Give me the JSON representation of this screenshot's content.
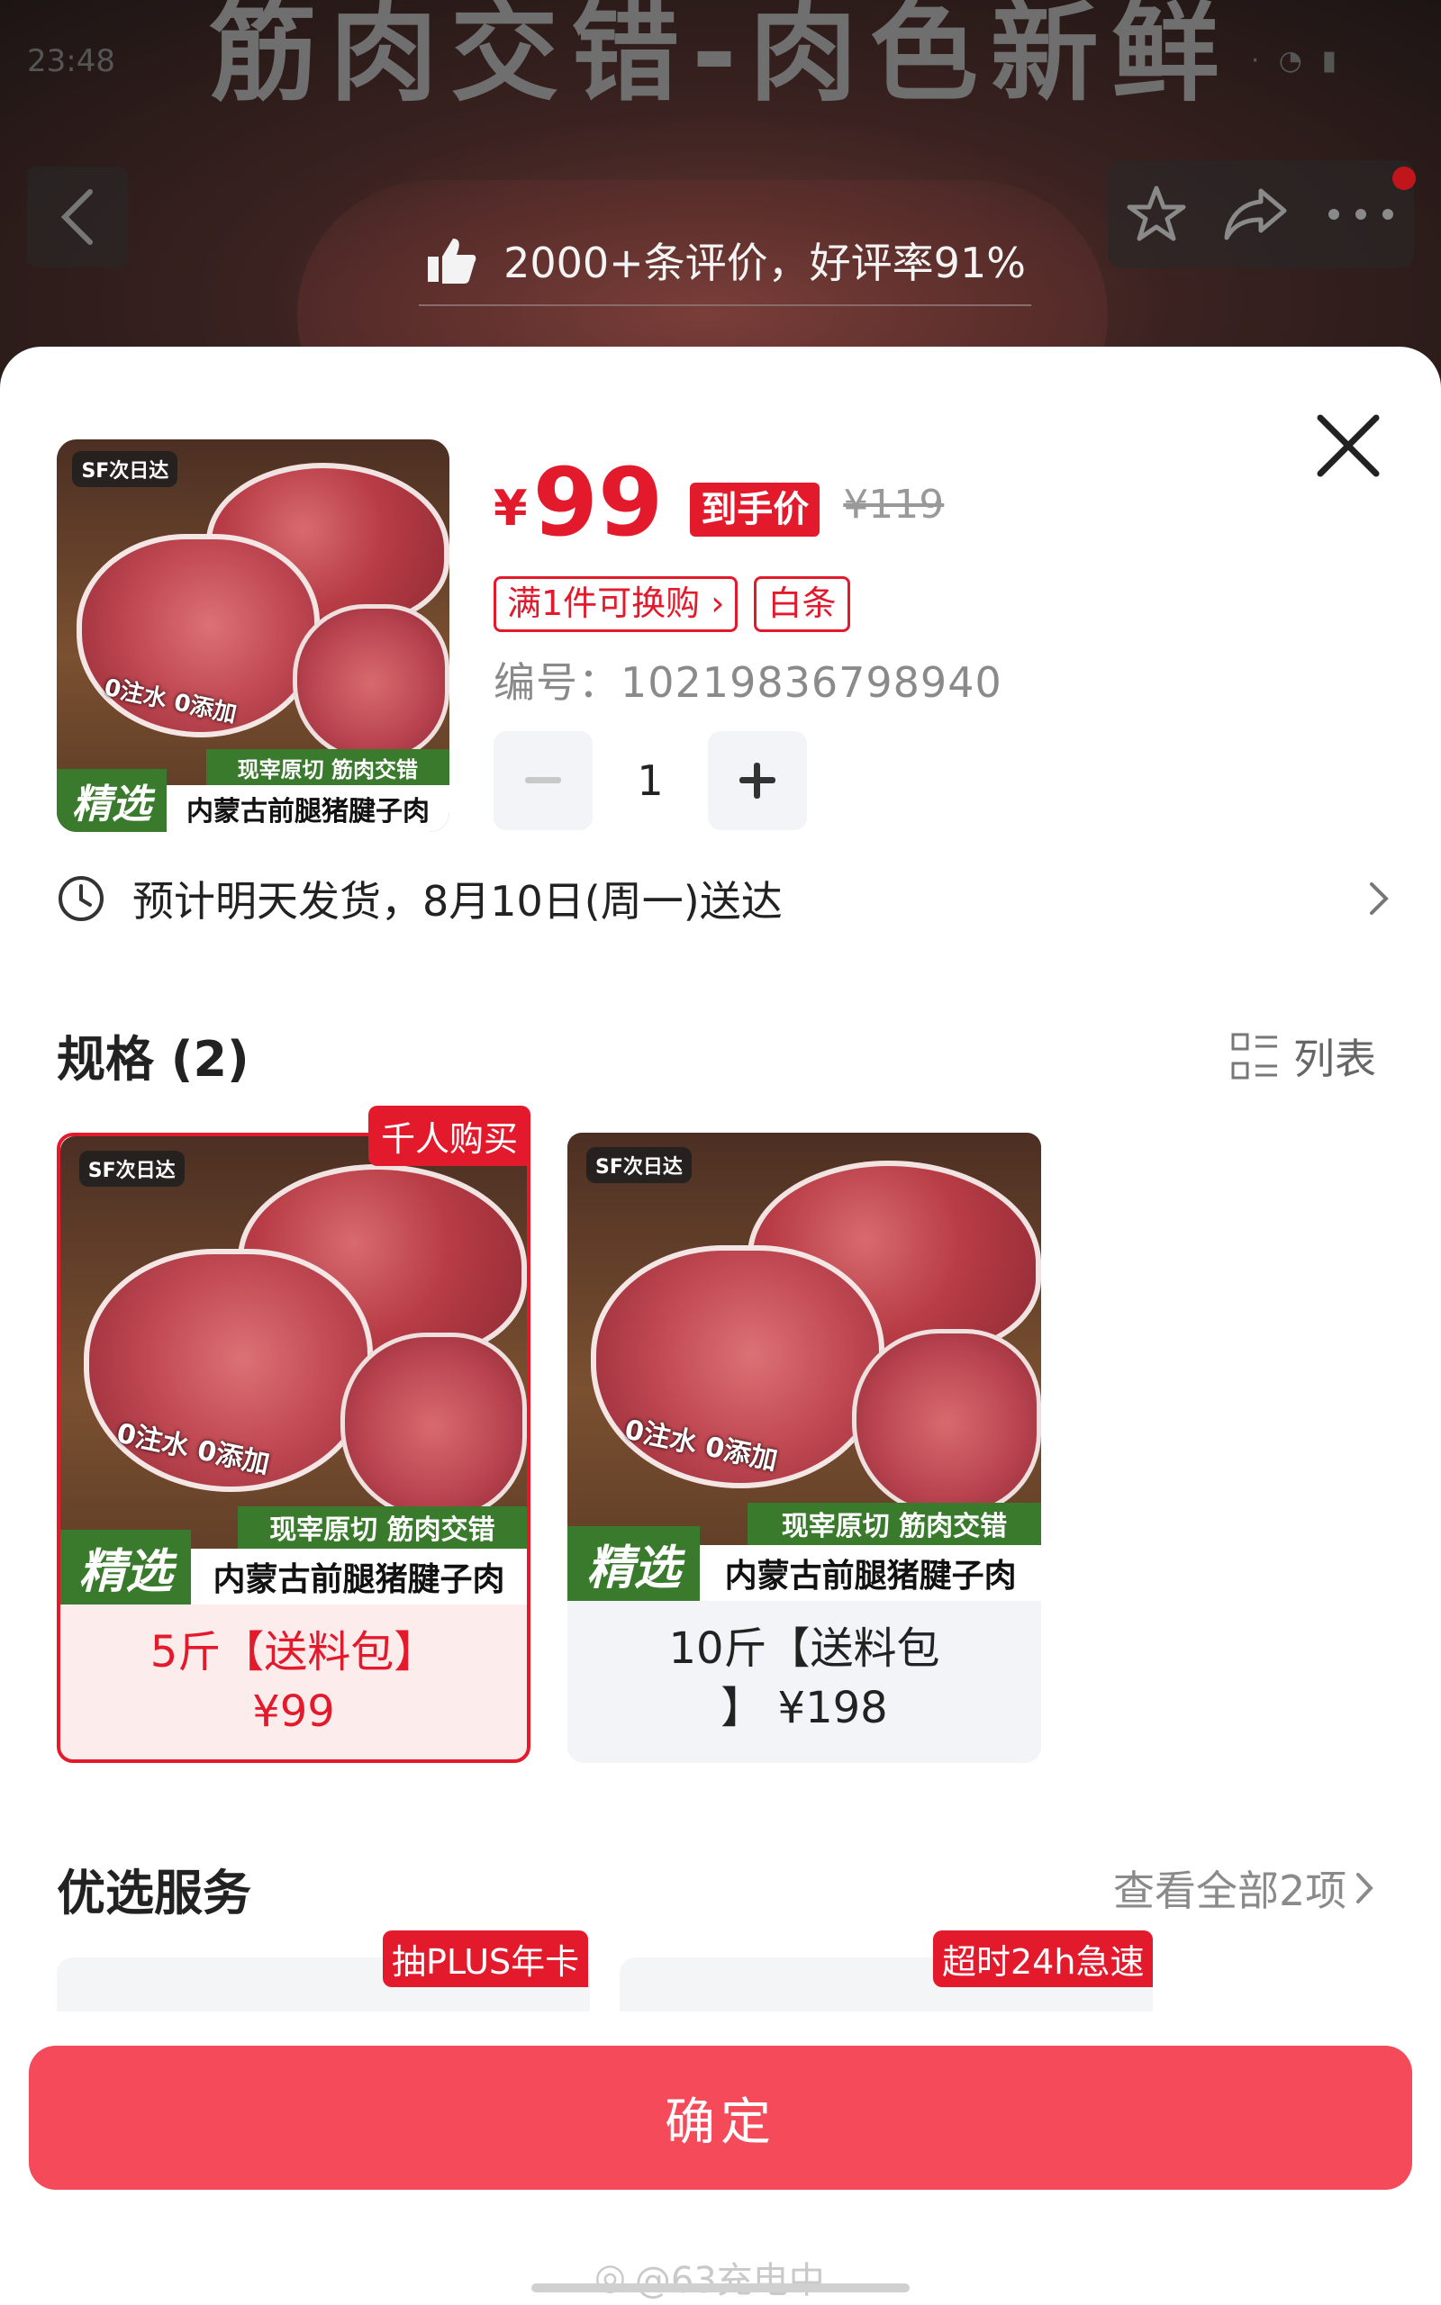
{
  "status_bar": {
    "time": "23:48"
  },
  "background": {
    "banner_text": "筋肉交错-肉色新鲜",
    "review_summary": "2000+条评价，好评率91%"
  },
  "product": {
    "logo_text": "SF次日达",
    "overlay_caption": "0注水 0添加",
    "green_caption": "现宰原切 筋肉交错",
    "badge_text": "精选",
    "name_caption": "内蒙古前腿猪腱子肉",
    "currency": "¥",
    "price": "99",
    "price_tag": "到手价",
    "original_price": "¥119",
    "promos": [
      "满1件可换购",
      "白条"
    ],
    "sku_label": "编号：",
    "sku_number": "10219836798940",
    "quantity": "1",
    "shipping": "预计明天发货，8月10日(周一)送达"
  },
  "specs": {
    "title": "规格 (2)",
    "list_toggle": "列表",
    "options": [
      {
        "badge": "千人购买",
        "label_line1": "5斤【送料包】",
        "label_line2": "¥99",
        "selected": true
      },
      {
        "label_line1": "10斤【送料包",
        "label_line2": "】  ¥198",
        "selected": false
      }
    ]
  },
  "services": {
    "title": "优选服务",
    "more": "查看全部2项",
    "badges": [
      "抽PLUS年卡",
      "超时24h急速"
    ]
  },
  "confirm_button": "确定",
  "watermark": "@63充电中",
  "colors": {
    "accent": "#e3192c",
    "button": "#f44a59"
  }
}
